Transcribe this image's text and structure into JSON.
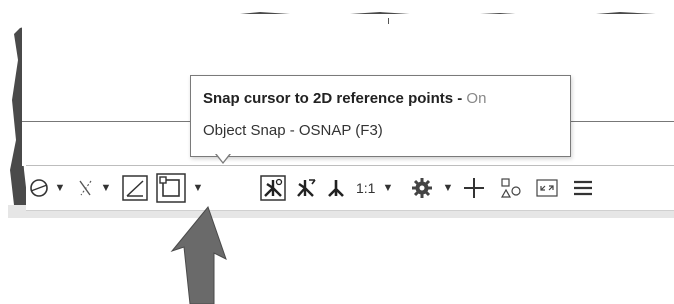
{
  "tooltip": {
    "title": "Snap cursor to 2D reference points - ",
    "state": "On",
    "subtitle": "Object Snap - OSNAP (F3)"
  },
  "statusbar": {
    "scale": "1:1",
    "icons": [
      "isodraft-icon",
      "dropdown-arrow-icon",
      "polar-tracking-icon",
      "dropdown-arrow-icon",
      "dynamic-ucs-icon",
      "object-snap-icon",
      "dropdown-arrow-icon",
      "annotation-visibility-icon",
      "auto-scale-icon",
      "annotation-scale-icon",
      "scale-dropdown-icon",
      "workspace-gear-icon",
      "dropdown-arrow-icon",
      "crosshair-plus-icon",
      "isolate-objects-icon",
      "fullscreen-icon",
      "customization-menu-icon"
    ]
  },
  "colors": {
    "tooltip_state": "#888888",
    "arrow": "#6a6a6a",
    "torn_shadow": "#2a2a2a"
  }
}
